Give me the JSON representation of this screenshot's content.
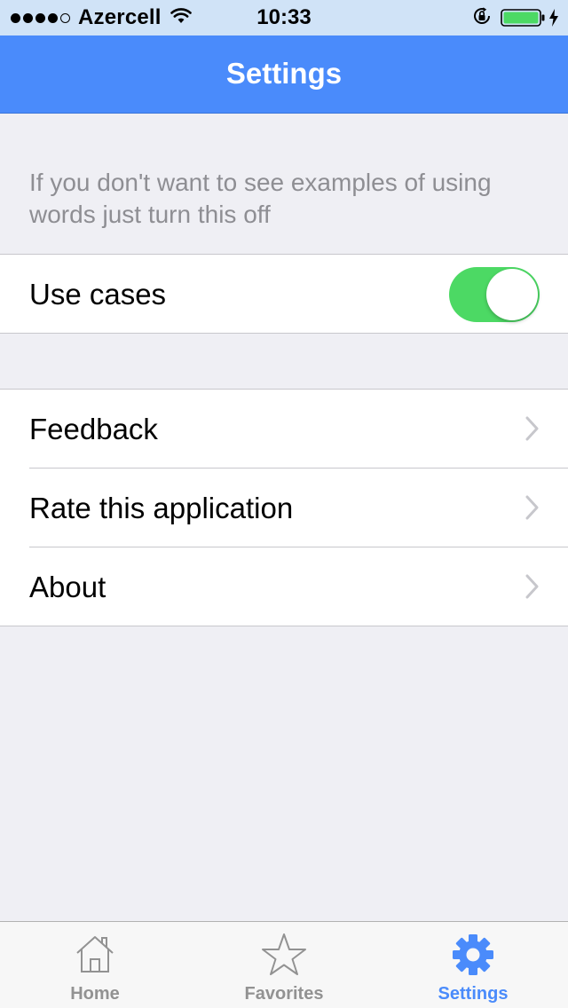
{
  "status_bar": {
    "carrier": "Azercell",
    "time": "10:33",
    "signal_bars_filled": 4,
    "signal_bars_total": 5,
    "battery_level": 0.95,
    "battery_color": "#4cd964"
  },
  "nav": {
    "title": "Settings",
    "background": "#4a8bfb"
  },
  "use_cases_section": {
    "description": "If you don't want to see examples of using words just turn this off",
    "toggle_label": "Use cases",
    "toggle_on": true,
    "toggle_color": "#4cd964"
  },
  "menu": {
    "items": [
      {
        "label": "Feedback",
        "icon": "chevron-right-icon"
      },
      {
        "label": "Rate this application",
        "icon": "chevron-right-icon"
      },
      {
        "label": "About",
        "icon": "chevron-right-icon"
      }
    ]
  },
  "tab_bar": {
    "tabs": [
      {
        "label": "Home",
        "icon": "home-icon",
        "active": false
      },
      {
        "label": "Favorites",
        "icon": "star-icon",
        "active": false
      },
      {
        "label": "Settings",
        "icon": "gear-icon",
        "active": true
      }
    ],
    "active_color": "#4a8bfb",
    "inactive_color": "#929292"
  }
}
